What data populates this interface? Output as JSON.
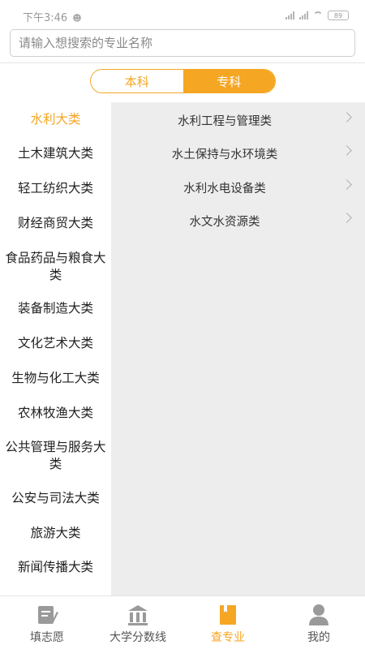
{
  "status_bar": {
    "time": "下午3:46",
    "battery": "89"
  },
  "search": {
    "placeholder": "请输入想搜索的专业名称",
    "value": ""
  },
  "segment": {
    "tabs": [
      "本科",
      "专科"
    ],
    "active_index": 1
  },
  "categories": [
    {
      "label": "水利大类",
      "selected": true
    },
    {
      "label": "土木建筑大类"
    },
    {
      "label": "轻工纺织大类"
    },
    {
      "label": "财经商贸大类"
    },
    {
      "label": "食品药品与粮食大类"
    },
    {
      "label": "装备制造大类"
    },
    {
      "label": "文化艺术大类"
    },
    {
      "label": "生物与化工大类"
    },
    {
      "label": "农林牧渔大类"
    },
    {
      "label": "公共管理与服务大类"
    },
    {
      "label": "公安与司法大类"
    },
    {
      "label": "旅游大类"
    },
    {
      "label": "新闻传播大类"
    }
  ],
  "subcategories": [
    {
      "label": "水利工程与管理类"
    },
    {
      "label": "水土保持与水环境类"
    },
    {
      "label": "水利水电设备类"
    },
    {
      "label": "水文水资源类"
    }
  ],
  "tabbar": [
    {
      "label": "填志愿",
      "icon": "edit-form-icon"
    },
    {
      "label": "大学分数线",
      "icon": "university-building-icon"
    },
    {
      "label": "查专业",
      "icon": "book-search-icon",
      "active": true
    },
    {
      "label": "我的",
      "icon": "user-profile-icon"
    }
  ],
  "colors": {
    "accent": "#f5a623",
    "right_panel_bg": "#ededed",
    "icon_gray": "#9a9a9a"
  }
}
